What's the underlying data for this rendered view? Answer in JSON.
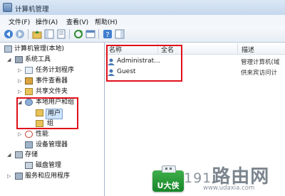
{
  "window": {
    "title": "计算机管理"
  },
  "menu": [
    "文件(F)",
    "操作(A)",
    "查看(V)",
    "帮助(H)"
  ],
  "tree": {
    "root": "计算机管理(本地)",
    "system_tools": "系统工具",
    "task_scheduler": "任务计划程序",
    "event_viewer": "事件查看器",
    "shared_folders": "共享文件夹",
    "local_users_groups": "本地用户和组",
    "users": "用户",
    "groups": "组",
    "performance": "性能",
    "device_manager": "设备管理器",
    "storage": "存储",
    "disk_management": "磁盘管理",
    "services_apps": "服务和应用程序"
  },
  "list": {
    "columns": [
      "名称",
      "全名",
      "描述"
    ],
    "rows": [
      {
        "name": "Administrat...",
        "fullname": "",
        "description": "管理计算机(域"
      },
      {
        "name": "Guest",
        "fullname": "",
        "description": "供来宾访问计"
      }
    ]
  },
  "watermark": {
    "badge_text": "U大侠",
    "site_digits": "191",
    "site_name": "路由",
    "site_suffix": "网",
    "url": "www.udaxia.com"
  },
  "colors": {
    "highlight_red": "#e0101a",
    "selection_blue": "#cde3fb"
  }
}
